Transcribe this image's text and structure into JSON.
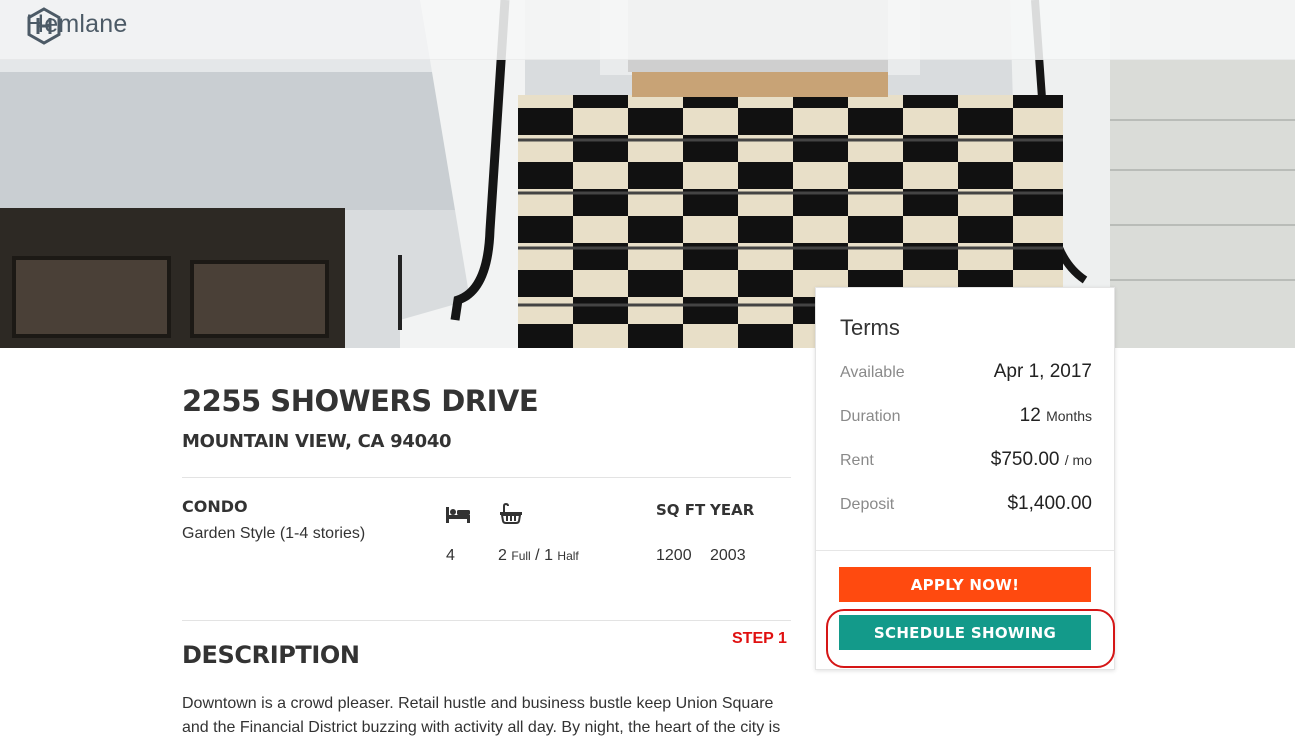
{
  "brand": {
    "name": "Hemlane"
  },
  "listing": {
    "address": "2255 SHOWERS DRIVE",
    "city_line": "MOUNTAIN VIEW, CA 94040",
    "property_type": "CONDO",
    "property_style": "Garden Style (1-4 stories)",
    "beds": "4",
    "baths_full": "2",
    "baths_full_label": "Full",
    "baths_half": "1",
    "baths_half_label": "Half",
    "baths_separator": "/",
    "sqft_label": "SQ FT",
    "sqft": "1200",
    "year_label": "YEAR",
    "year": "2003",
    "bed_icon": "bed-icon",
    "bath_icon": "bathtub-icon"
  },
  "description": {
    "heading": "DESCRIPTION",
    "text": "Downtown is a crowd pleaser. Retail hustle and business bustle keep Union Square and the Financial District buzzing with activity all day. By night, the heart of the city is"
  },
  "annotation": {
    "step_label": "STEP 1",
    "color": "#e01010"
  },
  "terms": {
    "title": "Terms",
    "available_label": "Available",
    "available_value": "Apr 1, 2017",
    "duration_label": "Duration",
    "duration_value": "12",
    "duration_unit": "Months",
    "rent_label": "Rent",
    "rent_value": "$750.00",
    "rent_unit": "/ mo",
    "deposit_label": "Deposit",
    "deposit_value": "$1,400.00",
    "apply_label": "APPLY NOW!",
    "schedule_label": "SCHEDULE SHOWING"
  },
  "colors": {
    "apply_button": "#ff4a0f",
    "schedule_button": "#139a8a",
    "logo": "#4c5a66",
    "highlight_ring": "#d51616"
  }
}
